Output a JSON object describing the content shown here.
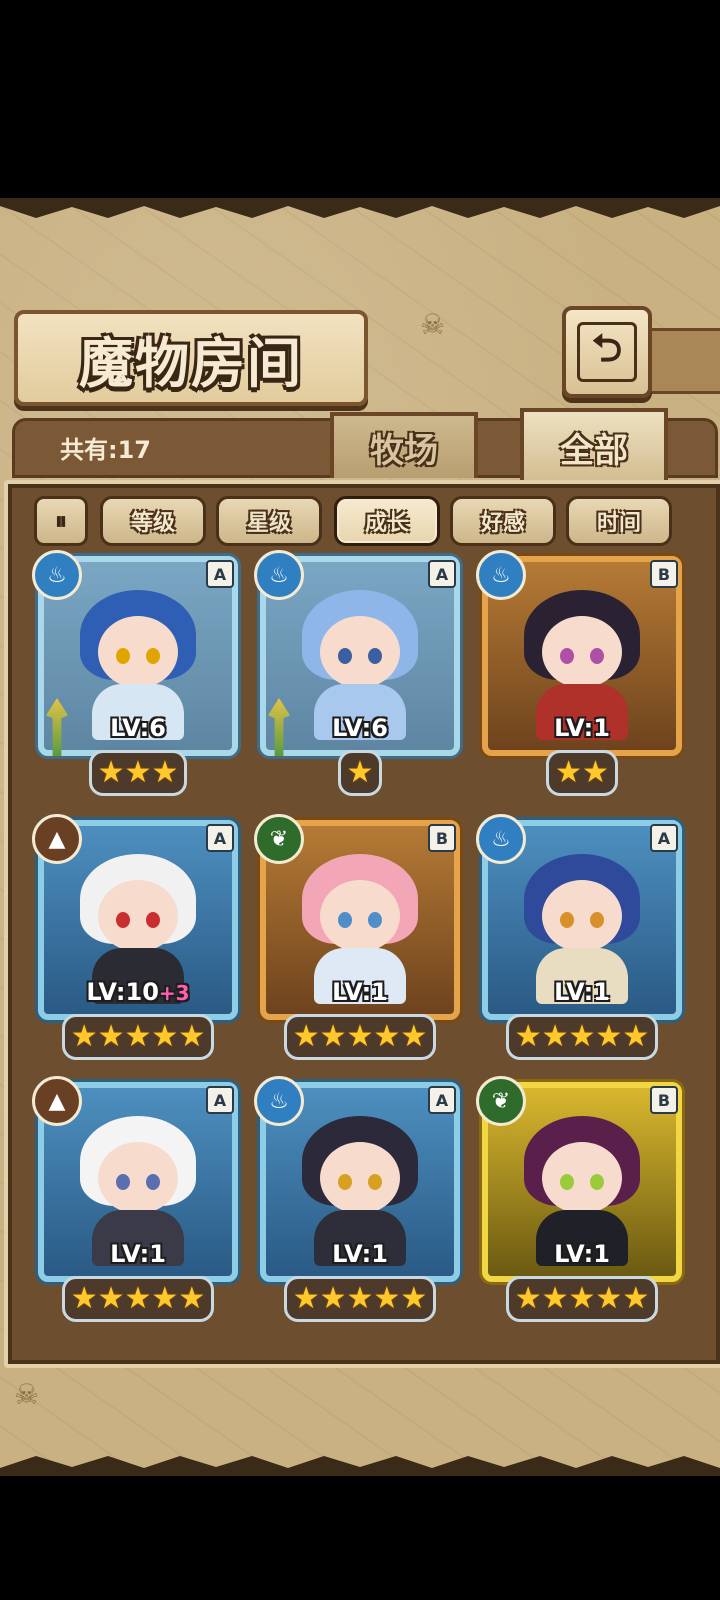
{
  "title": "魔物房间",
  "back_icon": "back-arrow-icon",
  "count_label": "共有:17",
  "tabs": [
    {
      "label": "牧场",
      "active": false
    },
    {
      "label": "全部",
      "active": true
    }
  ],
  "sort_buttons": [
    {
      "label": "等级",
      "selected": false
    },
    {
      "label": "星级",
      "selected": false
    },
    {
      "label": "成长",
      "selected": true
    },
    {
      "label": "好感",
      "selected": false
    },
    {
      "label": "时间",
      "selected": false
    }
  ],
  "filter_icon": "filter-toggle-icon",
  "monsters": [
    {
      "element": "water",
      "rank": "A",
      "level": "LV:6",
      "bonus": "",
      "stars": "★★★",
      "frame": "pale",
      "has_weapon": true
    },
    {
      "element": "water",
      "rank": "A",
      "level": "LV:6",
      "bonus": "",
      "stars": "★",
      "frame": "pale",
      "has_weapon": true
    },
    {
      "element": "water",
      "rank": "B",
      "level": "LV:1",
      "bonus": "",
      "stars": "★★",
      "frame": "gold",
      "has_weapon": false
    },
    {
      "element": "earth",
      "rank": "A",
      "level": "LV:10",
      "bonus": "+3",
      "stars": "★★★★★",
      "frame": "water",
      "has_weapon": false
    },
    {
      "element": "leaf",
      "rank": "B",
      "level": "LV:1",
      "bonus": "",
      "stars": "★★★★★",
      "frame": "gold",
      "has_weapon": false
    },
    {
      "element": "water",
      "rank": "A",
      "level": "LV:1",
      "bonus": "",
      "stars": "★★★★★",
      "frame": "water",
      "has_weapon": false
    },
    {
      "element": "earth",
      "rank": "A",
      "level": "LV:1",
      "bonus": "",
      "stars": "★★★★★",
      "frame": "water",
      "has_weapon": false
    },
    {
      "element": "water",
      "rank": "A",
      "level": "LV:1",
      "bonus": "",
      "stars": "★★★★★",
      "frame": "water",
      "has_weapon": false
    },
    {
      "element": "leaf",
      "rank": "B",
      "level": "LV:1",
      "bonus": "",
      "stars": "★★★★★",
      "frame": "yellow",
      "has_weapon": false
    }
  ],
  "colors": {
    "water_element": "#2f7fc1",
    "earth_element": "#6a4024",
    "leaf_element": "#2f6b2a",
    "star": "#ffc92b",
    "bonus": "#ff5fae"
  }
}
